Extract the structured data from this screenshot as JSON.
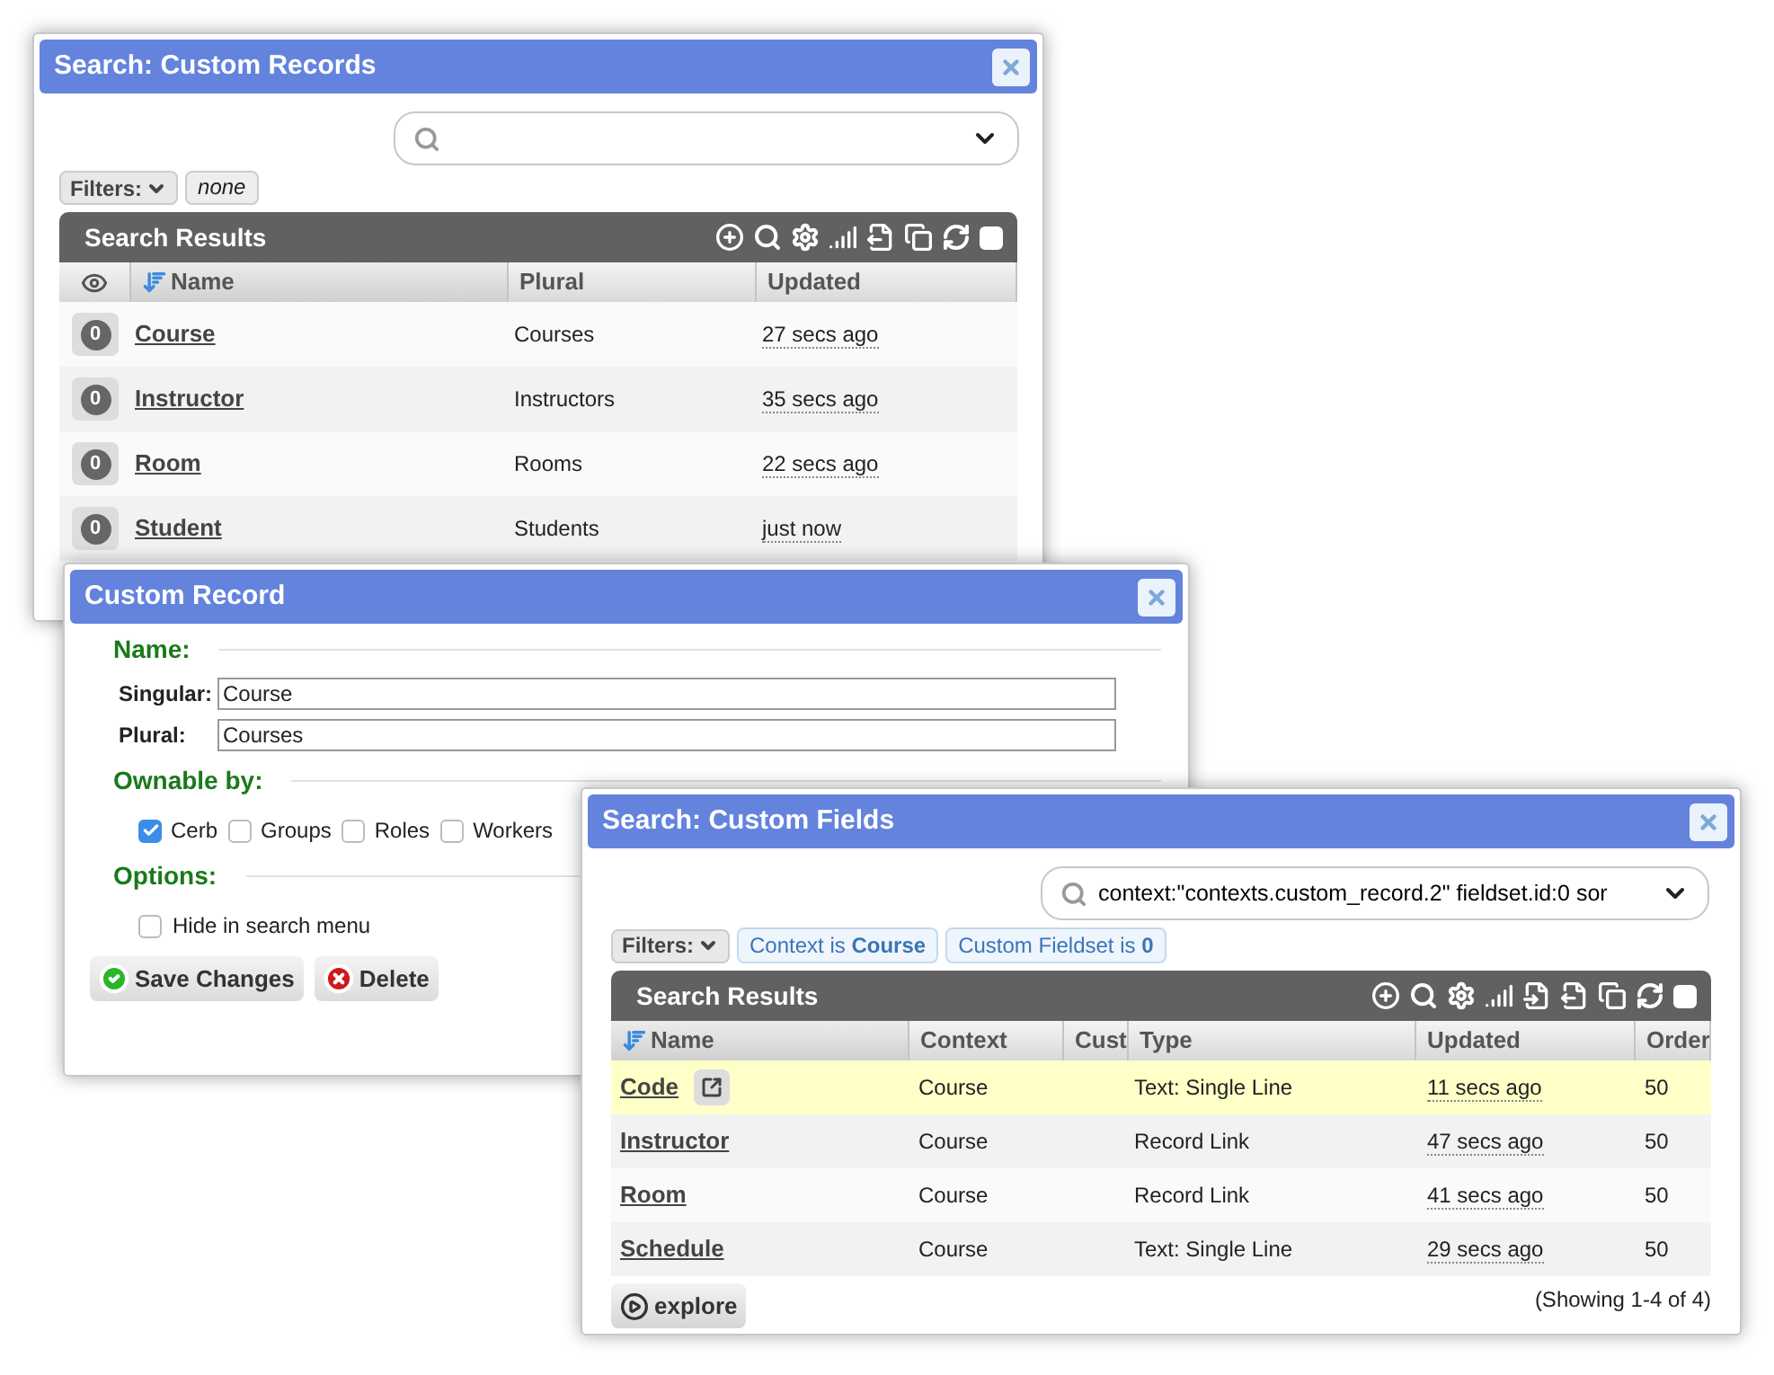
{
  "records_search": {
    "title": "Search: Custom Records",
    "filters": {
      "label": "Filters:",
      "chips": [
        {
          "text": "none",
          "kind": "plain"
        }
      ]
    },
    "results": {
      "title": "Search Results",
      "select_all": {
        "checked": false
      },
      "columns": [
        {
          "kind": "watch"
        },
        {
          "label": "Name",
          "kind": "text",
          "sorted": true
        },
        {
          "label": "Plural",
          "kind": "text",
          "sorted": false
        },
        {
          "label": "Updated",
          "kind": "text",
          "sorted": false
        }
      ],
      "rows": [
        {
          "watchers": "0",
          "name": "Course",
          "plural": "Courses",
          "updated": "27 secs ago"
        },
        {
          "watchers": "0",
          "name": "Instructor",
          "plural": "Instructors",
          "updated": "35 secs ago"
        },
        {
          "watchers": "0",
          "name": "Room",
          "plural": "Rooms",
          "updated": "22 secs ago"
        },
        {
          "watchers": "0",
          "name": "Student",
          "plural": "Students",
          "updated": "just now"
        }
      ]
    }
  },
  "custom_record": {
    "title": "Custom Record",
    "sections": [
      {
        "heading": "Name:",
        "kind": "fields",
        "fields": [
          {
            "label": "Singular:",
            "value": "Course"
          },
          {
            "label": "Plural:",
            "value": "Courses"
          }
        ]
      },
      {
        "heading": "Ownable by:",
        "kind": "checks",
        "options": [
          {
            "label": "Cerb",
            "checked": true
          },
          {
            "label": "Groups",
            "checked": false
          },
          {
            "label": "Roles",
            "checked": false
          },
          {
            "label": "Workers",
            "checked": false
          }
        ]
      },
      {
        "heading": "Options:",
        "kind": "list",
        "options": [
          {
            "label": "Hide in search menu",
            "checked": false
          }
        ]
      }
    ],
    "buttons": [
      {
        "label": "Save Changes",
        "kind": "save"
      },
      {
        "label": "Delete",
        "kind": "delete"
      }
    ]
  },
  "fields_search": {
    "title": "Search: Custom Fields",
    "search": {
      "value": "context:\"contexts.custom_record.2\" fieldset.id:0 sor"
    },
    "filters": {
      "label": "Filters:",
      "chips": [
        {
          "text": "Context is **Course**",
          "kind": "filter"
        },
        {
          "text": "Custom Fieldset is **0**",
          "kind": "filter"
        }
      ]
    },
    "results": {
      "title": "Search Results",
      "select_all": {
        "checked": false
      },
      "columns": [
        {
          "label": "Name",
          "sorted": true
        },
        {
          "label": "Context",
          "sorted": false
        },
        {
          "label": "Cust",
          "sorted": false
        },
        {
          "label": "Type",
          "sorted": false
        },
        {
          "label": "Updated",
          "sorted": false
        },
        {
          "label": "Order",
          "sorted": false
        }
      ],
      "rows": [
        {
          "name": "Code",
          "context": "Course",
          "type": "Text: Single Line",
          "updated": "11 secs ago",
          "order": "50",
          "selected": true,
          "peek": true
        },
        {
          "name": "Instructor",
          "context": "Course",
          "type": "Record Link",
          "updated": "47 secs ago",
          "order": "50",
          "selected": false,
          "peek": false
        },
        {
          "name": "Room",
          "context": "Course",
          "type": "Record Link",
          "updated": "41 secs ago",
          "order": "50",
          "selected": false,
          "peek": false
        },
        {
          "name": "Schedule",
          "context": "Course",
          "type": "Text: Single Line",
          "updated": "29 secs ago",
          "order": "50",
          "selected": false,
          "peek": false
        }
      ]
    },
    "footer": {
      "explore": "explore",
      "summary": "(Showing 1-4 of 4)"
    }
  }
}
